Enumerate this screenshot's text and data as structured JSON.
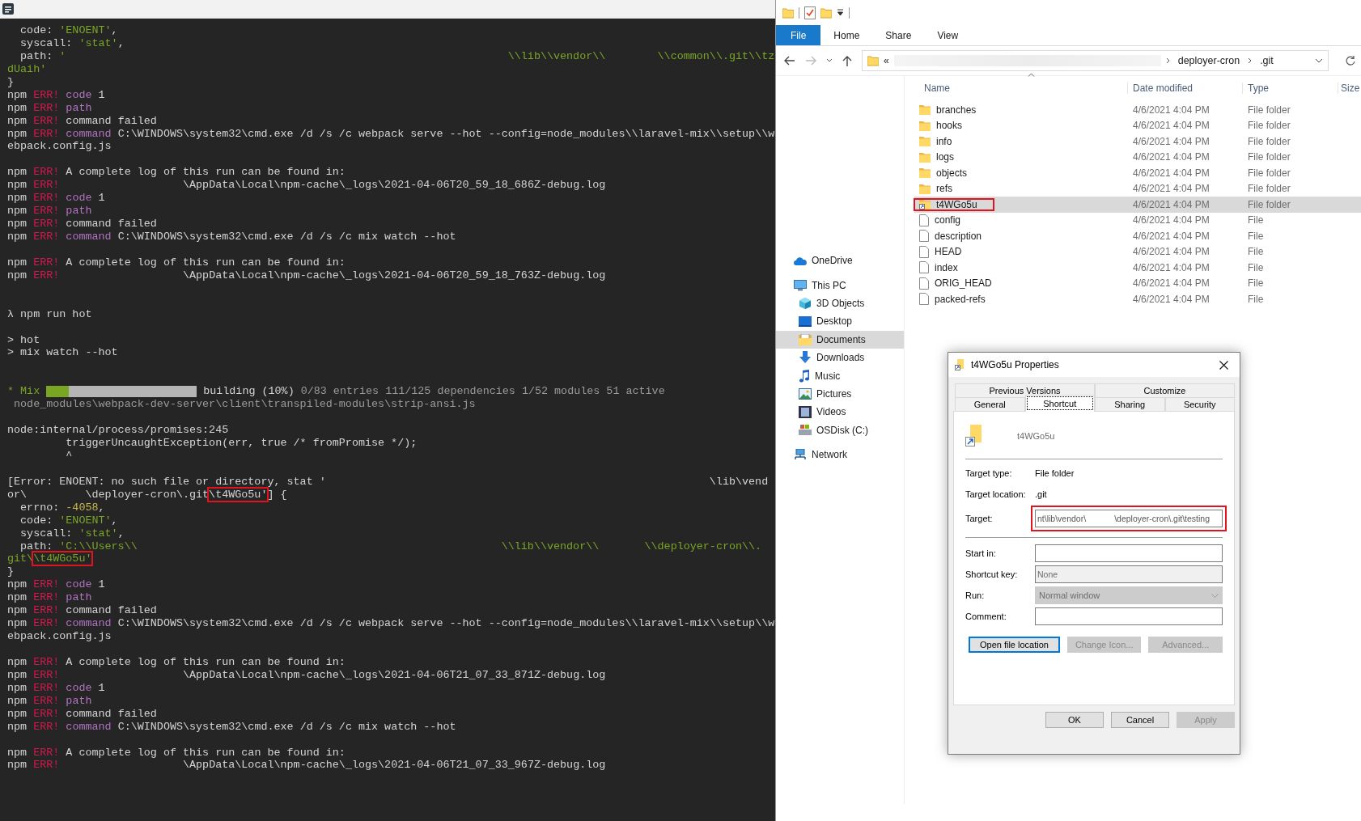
{
  "terminal": {
    "lines": [
      {
        "kind": "text",
        "segments": [
          {
            "kind": "plain",
            "text": "  code: "
          },
          {
            "kind": "str",
            "text": "'ENOENT'"
          },
          {
            "kind": "plain",
            "text": ","
          }
        ]
      },
      {
        "kind": "text",
        "segments": [
          {
            "kind": "plain",
            "text": "  syscall: "
          },
          {
            "kind": "str",
            "text": "'stat'"
          },
          {
            "kind": "plain",
            "text": ","
          }
        ]
      },
      {
        "kind": "text",
        "segments": [
          {
            "kind": "plain",
            "text": "  path: "
          },
          {
            "kind": "str",
            "text": "'                                                                    \\\\lib\\\\vendor\\\\        \\\\common\\\\.git\\\\tz"
          }
        ]
      },
      {
        "kind": "text",
        "segments": [
          {
            "kind": "str",
            "text": "dUaih'"
          }
        ]
      },
      {
        "kind": "text",
        "segments": [
          {
            "kind": "plain",
            "text": "}"
          }
        ]
      },
      {
        "kind": "text",
        "segments": [
          {
            "kind": "plain",
            "text": "npm "
          },
          {
            "kind": "err",
            "text": "ERR!"
          },
          {
            "kind": "key",
            "text": " code"
          },
          {
            "kind": "plain",
            "text": " 1"
          }
        ]
      },
      {
        "kind": "text",
        "segments": [
          {
            "kind": "plain",
            "text": "npm "
          },
          {
            "kind": "err",
            "text": "ERR!"
          },
          {
            "kind": "key",
            "text": " path"
          }
        ]
      },
      {
        "kind": "text",
        "segments": [
          {
            "kind": "plain",
            "text": "npm "
          },
          {
            "kind": "err",
            "text": "ERR!"
          },
          {
            "kind": "plain",
            "text": " command failed"
          }
        ]
      },
      {
        "kind": "text",
        "segments": [
          {
            "kind": "plain",
            "text": "npm "
          },
          {
            "kind": "err",
            "text": "ERR!"
          },
          {
            "kind": "key",
            "text": " command"
          },
          {
            "kind": "plain",
            "text": " C:\\WINDOWS\\system32\\cmd.exe /d /s /c webpack serve --hot --config=node_modules\\\\laravel-mix\\\\setup\\\\w"
          }
        ]
      },
      {
        "kind": "text",
        "segments": [
          {
            "kind": "plain",
            "text": "ebpack.config.js"
          }
        ]
      },
      {
        "kind": "blank"
      },
      {
        "kind": "text",
        "segments": [
          {
            "kind": "plain",
            "text": "npm "
          },
          {
            "kind": "err",
            "text": "ERR!"
          },
          {
            "kind": "plain",
            "text": " A complete log of this run can be found in:"
          }
        ]
      },
      {
        "kind": "text",
        "segments": [
          {
            "kind": "plain",
            "text": "npm "
          },
          {
            "kind": "err",
            "text": "ERR!"
          },
          {
            "kind": "plain",
            "text": "                   \\AppData\\Local\\npm-cache\\_logs\\2021-04-06T20_59_18_686Z-debug.log"
          }
        ]
      },
      {
        "kind": "text",
        "segments": [
          {
            "kind": "plain",
            "text": "npm "
          },
          {
            "kind": "err",
            "text": "ERR!"
          },
          {
            "kind": "key",
            "text": " code"
          },
          {
            "kind": "plain",
            "text": " 1"
          }
        ]
      },
      {
        "kind": "text",
        "segments": [
          {
            "kind": "plain",
            "text": "npm "
          },
          {
            "kind": "err",
            "text": "ERR!"
          },
          {
            "kind": "key",
            "text": " path"
          }
        ]
      },
      {
        "kind": "text",
        "segments": [
          {
            "kind": "plain",
            "text": "npm "
          },
          {
            "kind": "err",
            "text": "ERR!"
          },
          {
            "kind": "plain",
            "text": " command failed"
          }
        ]
      },
      {
        "kind": "text",
        "segments": [
          {
            "kind": "plain",
            "text": "npm "
          },
          {
            "kind": "err",
            "text": "ERR!"
          },
          {
            "kind": "key",
            "text": " command"
          },
          {
            "kind": "plain",
            "text": " C:\\WINDOWS\\system32\\cmd.exe /d /s /c mix watch --hot"
          }
        ]
      },
      {
        "kind": "blank"
      },
      {
        "kind": "text",
        "segments": [
          {
            "kind": "plain",
            "text": "npm "
          },
          {
            "kind": "err",
            "text": "ERR!"
          },
          {
            "kind": "plain",
            "text": " A complete log of this run can be found in:"
          }
        ]
      },
      {
        "kind": "text",
        "segments": [
          {
            "kind": "plain",
            "text": "npm "
          },
          {
            "kind": "err",
            "text": "ERR!"
          },
          {
            "kind": "plain",
            "text": "                   \\AppData\\Local\\npm-cache\\_logs\\2021-04-06T20_59_18_763Z-debug.log"
          }
        ]
      },
      {
        "kind": "blank"
      },
      {
        "kind": "blank"
      },
      {
        "kind": "text",
        "segments": [
          {
            "kind": "plain",
            "text": "λ npm run hot"
          }
        ]
      },
      {
        "kind": "blank"
      },
      {
        "kind": "text",
        "segments": [
          {
            "kind": "plain",
            "text": "> hot"
          }
        ]
      },
      {
        "kind": "text",
        "segments": [
          {
            "kind": "plain",
            "text": "> mix watch --hot"
          }
        ]
      },
      {
        "kind": "blank"
      },
      {
        "kind": "blank"
      },
      {
        "kind": "text",
        "segments": [
          {
            "kind": "ok",
            "text": "* Mix"
          },
          {
            "kind": "progress",
            "level": 0.15
          },
          {
            "kind": "plain",
            "text": "building (10%)"
          },
          {
            "kind": "dim",
            "text": "0/83 entries 111/125 dependencies 1/52 modules 51 active"
          }
        ]
      },
      {
        "kind": "text",
        "segments": [
          {
            "kind": "dim",
            "text": " node_modules\\webpack-dev-server\\client\\transpiled-modules\\strip-ansi.js"
          }
        ]
      },
      {
        "kind": "blank"
      },
      {
        "kind": "text",
        "segments": [
          {
            "kind": "plain",
            "text": "node:internal/process/promises:245"
          }
        ]
      },
      {
        "kind": "text",
        "segments": [
          {
            "kind": "plain",
            "text": "         triggerUncaughtException(err, true /* fromPromise */);"
          }
        ]
      },
      {
        "kind": "text",
        "segments": [
          {
            "kind": "plain",
            "text": "         ^"
          }
        ]
      },
      {
        "kind": "blank"
      },
      {
        "kind": "text",
        "segments": [
          {
            "kind": "plain",
            "text": "[Error: ENOENT: no such file or directory, stat '                                                           \\lib\\vend"
          }
        ]
      },
      {
        "kind": "text",
        "segments": [
          {
            "kind": "plain",
            "text": "or\\         \\deployer-cron\\.git"
          },
          {
            "kind": "mark",
            "text": "\\t4WGo5u'"
          },
          {
            "kind": "plain",
            "text": "] {"
          }
        ]
      },
      {
        "kind": "text",
        "segments": [
          {
            "kind": "plain",
            "text": "  errno: "
          },
          {
            "kind": "num",
            "text": "-4058"
          },
          {
            "kind": "plain",
            "text": ","
          }
        ]
      },
      {
        "kind": "text",
        "segments": [
          {
            "kind": "plain",
            "text": "  code: "
          },
          {
            "kind": "str",
            "text": "'ENOENT'"
          },
          {
            "kind": "plain",
            "text": ","
          }
        ]
      },
      {
        "kind": "text",
        "segments": [
          {
            "kind": "plain",
            "text": "  syscall: "
          },
          {
            "kind": "str",
            "text": "'stat'"
          },
          {
            "kind": "plain",
            "text": ","
          }
        ]
      },
      {
        "kind": "text",
        "segments": [
          {
            "kind": "plain",
            "text": "  path: "
          },
          {
            "kind": "str",
            "text": "'C:\\\\Users\\\\                                                        \\\\lib\\\\vendor\\\\       \\\\deployer-cron\\\\."
          }
        ]
      },
      {
        "kind": "text",
        "segments": [
          {
            "kind": "str",
            "text": "git\\"
          },
          {
            "kind": "markstr",
            "text": "\\t4WGo5u'"
          }
        ]
      },
      {
        "kind": "text",
        "segments": [
          {
            "kind": "plain",
            "text": "}"
          }
        ]
      },
      {
        "kind": "text",
        "segments": [
          {
            "kind": "plain",
            "text": "npm "
          },
          {
            "kind": "err",
            "text": "ERR!"
          },
          {
            "kind": "key",
            "text": " code"
          },
          {
            "kind": "plain",
            "text": " 1"
          }
        ]
      },
      {
        "kind": "text",
        "segments": [
          {
            "kind": "plain",
            "text": "npm "
          },
          {
            "kind": "err",
            "text": "ERR!"
          },
          {
            "kind": "key",
            "text": " path"
          }
        ]
      },
      {
        "kind": "text",
        "segments": [
          {
            "kind": "plain",
            "text": "npm "
          },
          {
            "kind": "err",
            "text": "ERR!"
          },
          {
            "kind": "plain",
            "text": " command failed"
          }
        ]
      },
      {
        "kind": "text",
        "segments": [
          {
            "kind": "plain",
            "text": "npm "
          },
          {
            "kind": "err",
            "text": "ERR!"
          },
          {
            "kind": "key",
            "text": " command"
          },
          {
            "kind": "plain",
            "text": " C:\\WINDOWS\\system32\\cmd.exe /d /s /c webpack serve --hot --config=node_modules\\\\laravel-mix\\\\setup\\\\w"
          }
        ]
      },
      {
        "kind": "text",
        "segments": [
          {
            "kind": "plain",
            "text": "ebpack.config.js"
          }
        ]
      },
      {
        "kind": "blank"
      },
      {
        "kind": "text",
        "segments": [
          {
            "kind": "plain",
            "text": "npm "
          },
          {
            "kind": "err",
            "text": "ERR!"
          },
          {
            "kind": "plain",
            "text": " A complete log of this run can be found in:"
          }
        ]
      },
      {
        "kind": "text",
        "segments": [
          {
            "kind": "plain",
            "text": "npm "
          },
          {
            "kind": "err",
            "text": "ERR!"
          },
          {
            "kind": "plain",
            "text": "                   \\AppData\\Local\\npm-cache\\_logs\\2021-04-06T21_07_33_871Z-debug.log"
          }
        ]
      },
      {
        "kind": "text",
        "segments": [
          {
            "kind": "plain",
            "text": "npm "
          },
          {
            "kind": "err",
            "text": "ERR!"
          },
          {
            "kind": "key",
            "text": " code"
          },
          {
            "kind": "plain",
            "text": " 1"
          }
        ]
      },
      {
        "kind": "text",
        "segments": [
          {
            "kind": "plain",
            "text": "npm "
          },
          {
            "kind": "err",
            "text": "ERR!"
          },
          {
            "kind": "key",
            "text": " path"
          }
        ]
      },
      {
        "kind": "text",
        "segments": [
          {
            "kind": "plain",
            "text": "npm "
          },
          {
            "kind": "err",
            "text": "ERR!"
          },
          {
            "kind": "plain",
            "text": " command failed"
          }
        ]
      },
      {
        "kind": "text",
        "segments": [
          {
            "kind": "plain",
            "text": "npm "
          },
          {
            "kind": "err",
            "text": "ERR!"
          },
          {
            "kind": "key",
            "text": " command"
          },
          {
            "kind": "plain",
            "text": " C:\\WINDOWS\\system32\\cmd.exe /d /s /c mix watch --hot"
          }
        ]
      },
      {
        "kind": "blank"
      },
      {
        "kind": "text",
        "segments": [
          {
            "kind": "plain",
            "text": "npm "
          },
          {
            "kind": "err",
            "text": "ERR!"
          },
          {
            "kind": "plain",
            "text": " A complete log of this run can be found in:"
          }
        ]
      },
      {
        "kind": "text",
        "segments": [
          {
            "kind": "plain",
            "text": "npm "
          },
          {
            "kind": "err",
            "text": "ERR!"
          },
          {
            "kind": "plain",
            "text": "                   \\AppData\\Local\\npm-cache\\_logs\\2021-04-06T21_07_33_967Z-debug.log"
          }
        ]
      }
    ]
  },
  "explorer": {
    "ribbon_tabs": [
      {
        "label": "File",
        "selected": true
      },
      {
        "label": "Home",
        "selected": false
      },
      {
        "label": "Share",
        "selected": false
      },
      {
        "label": "View",
        "selected": false
      }
    ],
    "address": {
      "overflow": "«",
      "breadcrumbs": [
        "deployer-cron",
        ".git"
      ]
    },
    "nav": [
      {
        "label": "OneDrive",
        "kind": "cloud",
        "selected": false
      },
      {
        "label": "This PC",
        "kind": "computer",
        "selected": false,
        "children": [
          {
            "label": "3D Objects",
            "kind": "cube",
            "selected": false
          },
          {
            "label": "Desktop",
            "kind": "desktop",
            "selected": false
          },
          {
            "label": "Documents",
            "kind": "documents",
            "selected": true
          },
          {
            "label": "Downloads",
            "kind": "downloads",
            "selected": false
          },
          {
            "label": "Music",
            "kind": "music",
            "selected": false
          },
          {
            "label": "Pictures",
            "kind": "pictures",
            "selected": false
          },
          {
            "label": "Videos",
            "kind": "videos",
            "selected": false
          },
          {
            "label": "OSDisk (C:)",
            "kind": "drive",
            "selected": false
          }
        ]
      },
      {
        "label": "Network",
        "kind": "network",
        "selected": false
      }
    ],
    "columns": [
      "Name",
      "Date modified",
      "Type",
      "Size"
    ],
    "rows": [
      {
        "name": "branches",
        "date": "4/6/2021 4:04 PM",
        "type": "File folder",
        "kind": "folder",
        "selected": false,
        "highlighted": false
      },
      {
        "name": "hooks",
        "date": "4/6/2021 4:04 PM",
        "type": "File folder",
        "kind": "folder",
        "selected": false,
        "highlighted": false
      },
      {
        "name": "info",
        "date": "4/6/2021 4:04 PM",
        "type": "File folder",
        "kind": "folder",
        "selected": false,
        "highlighted": false
      },
      {
        "name": "logs",
        "date": "4/6/2021 4:04 PM",
        "type": "File folder",
        "kind": "folder",
        "selected": false,
        "highlighted": false
      },
      {
        "name": "objects",
        "date": "4/6/2021 4:04 PM",
        "type": "File folder",
        "kind": "folder",
        "selected": false,
        "highlighted": false
      },
      {
        "name": "refs",
        "date": "4/6/2021 4:04 PM",
        "type": "File folder",
        "kind": "folder",
        "selected": false,
        "highlighted": false
      },
      {
        "name": "t4WGo5u",
        "date": "4/6/2021 4:04 PM",
        "type": "File folder",
        "kind": "shortcut",
        "selected": true,
        "highlighted": true
      },
      {
        "name": "config",
        "date": "4/6/2021 4:04 PM",
        "type": "File",
        "kind": "file",
        "selected": false,
        "highlighted": false
      },
      {
        "name": "description",
        "date": "4/6/2021 4:04 PM",
        "type": "File",
        "kind": "file",
        "selected": false,
        "highlighted": false
      },
      {
        "name": "HEAD",
        "date": "4/6/2021 4:04 PM",
        "type": "File",
        "kind": "file",
        "selected": false,
        "highlighted": false
      },
      {
        "name": "index",
        "date": "4/6/2021 4:04 PM",
        "type": "File",
        "kind": "file",
        "selected": false,
        "highlighted": false
      },
      {
        "name": "ORIG_HEAD",
        "date": "4/6/2021 4:04 PM",
        "type": "File",
        "kind": "file",
        "selected": false,
        "highlighted": false
      },
      {
        "name": "packed-refs",
        "date": "4/6/2021 4:04 PM",
        "type": "File",
        "kind": "file",
        "selected": false,
        "highlighted": false
      }
    ]
  },
  "dialog": {
    "title": "t4WGo5u Properties",
    "tab_rows": [
      [
        {
          "label": "Previous Versions",
          "selected": false
        },
        {
          "label": "Customize",
          "selected": false
        }
      ],
      [
        {
          "label": "General",
          "selected": false
        },
        {
          "label": "Shortcut",
          "selected": true
        },
        {
          "label": "Sharing",
          "selected": false
        },
        {
          "label": "Security",
          "selected": false
        }
      ]
    ],
    "name": "t4WGo5u",
    "groups": [
      [
        {
          "kind": "info",
          "label": "Target type:",
          "value": "File folder"
        },
        {
          "kind": "info",
          "label": "Target location:",
          "value": ".git"
        },
        {
          "kind": "input",
          "label": "Target:",
          "value": "nt\\lib\\vendor\\            \\deployer-cron\\.git\\testing",
          "disabled": false,
          "highlighted": true
        }
      ],
      [
        {
          "kind": "input",
          "label": "Start in:",
          "disabled": false,
          "highlighted": false
        },
        {
          "kind": "input",
          "label": "Shortcut key:",
          "value": "None",
          "disabled": true,
          "highlighted": false
        },
        {
          "kind": "select",
          "label": "Run:",
          "value": "Normal window",
          "disabled": true
        },
        {
          "kind": "input",
          "label": "Comment:",
          "disabled": false,
          "highlighted": false
        }
      ]
    ],
    "actions": [
      {
        "label": "Open file location",
        "default": true,
        "disabled": false
      },
      {
        "label": "Change Icon...",
        "default": false,
        "disabled": true
      },
      {
        "label": "Advanced...",
        "default": false,
        "disabled": true
      }
    ],
    "buttons": [
      {
        "label": "OK",
        "disabled": false
      },
      {
        "label": "Cancel",
        "disabled": false
      },
      {
        "label": "Apply",
        "disabled": true
      }
    ]
  }
}
